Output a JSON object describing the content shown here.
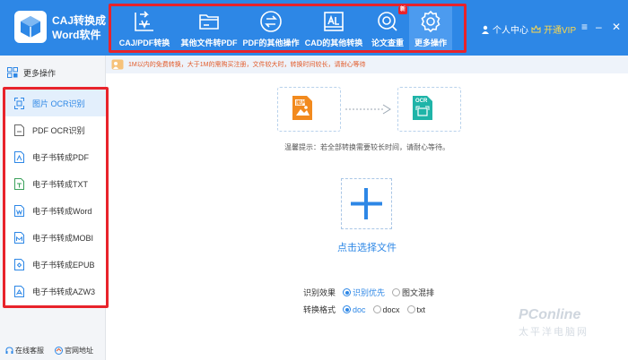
{
  "app": {
    "title_line1": "CAJ转换成",
    "title_line2": "Word软件"
  },
  "nav": [
    {
      "label": "CAJ/PDF转换",
      "icon": "caj-convert-icon",
      "active": false
    },
    {
      "label": "其他文件转PDF",
      "icon": "folder-icon",
      "active": false
    },
    {
      "label": "PDF的其他操作",
      "icon": "swap-arrows-icon",
      "active": false
    },
    {
      "label": "CAD的其他转换",
      "icon": "cad-drawing-icon",
      "active": false
    },
    {
      "label": "论文查重",
      "icon": "paper-check-icon",
      "active": false,
      "badge": "新"
    },
    {
      "label": "更多操作",
      "icon": "gear-icon",
      "active": true
    }
  ],
  "header": {
    "personal_center": "个人中心",
    "vip": "开通VIP",
    "colors": {
      "bar": "#2d87e6",
      "vip": "#ffd94a"
    }
  },
  "sidebar": {
    "title": "更多操作",
    "items": [
      {
        "label": "图片 OCR识别",
        "active": true
      },
      {
        "label": "PDF OCR识别",
        "active": false
      },
      {
        "label": "电子书转成PDF",
        "active": false
      },
      {
        "label": "电子书转成TXT",
        "active": false
      },
      {
        "label": "电子书转成Word",
        "active": false
      },
      {
        "label": "电子书转成MOBI",
        "active": false
      },
      {
        "label": "电子书转成EPUB",
        "active": false
      },
      {
        "label": "电子书转成AZW3",
        "active": false
      }
    ],
    "footer": {
      "service": "在线客服",
      "website": "官网地址"
    }
  },
  "notice": "1M以内的免费转换，大于1M的需购买注册，文件较大时，转换时间较长，请耐心等待",
  "flow": {
    "from_label": "图片",
    "to_label": "OCR"
  },
  "tip": "温馨提示：若全部转换需要较长时间，请耐心等待。",
  "upload": {
    "label": "点击选择文件"
  },
  "options": {
    "recognition": {
      "label": "识别效果",
      "choices": [
        "识别优先",
        "图文混排"
      ],
      "selected": 0
    },
    "format": {
      "label": "转换格式",
      "choices": [
        "doc",
        "docx",
        "txt"
      ],
      "selected": 0
    }
  },
  "watermark": {
    "brand": "PConline",
    "sub": "太平洋电脑网"
  }
}
